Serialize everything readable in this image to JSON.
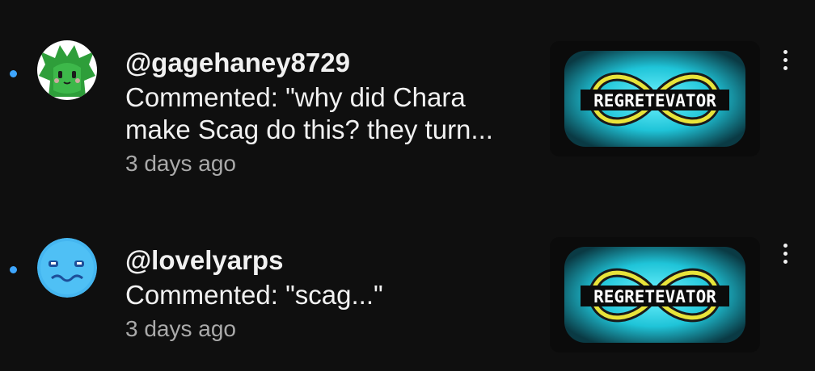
{
  "colors": {
    "background": "#0f0f0f",
    "unread_dot": "#3ea6ff",
    "primary_text": "#f1f1f1",
    "secondary_text": "#aaaaaa",
    "thumb_glow": "#33ddee",
    "logo_ring": "#e8e43a"
  },
  "notifications": [
    {
      "handle": "@gagehaney8729",
      "comment": "Commented: \"why did Chara make Scag do this? they turn...",
      "time": "3 days ago",
      "avatar_icon": "green-creature-avatar",
      "thumbnail_logo": "REGRETEVATOR",
      "more_icon": "more-vertical-icon"
    },
    {
      "handle": "@lovelyarps",
      "comment": "Commented: \"scag...\"",
      "time": "3 days ago",
      "avatar_icon": "blue-face-avatar",
      "thumbnail_logo": "REGRETEVATOR",
      "more_icon": "more-vertical-icon"
    }
  ]
}
